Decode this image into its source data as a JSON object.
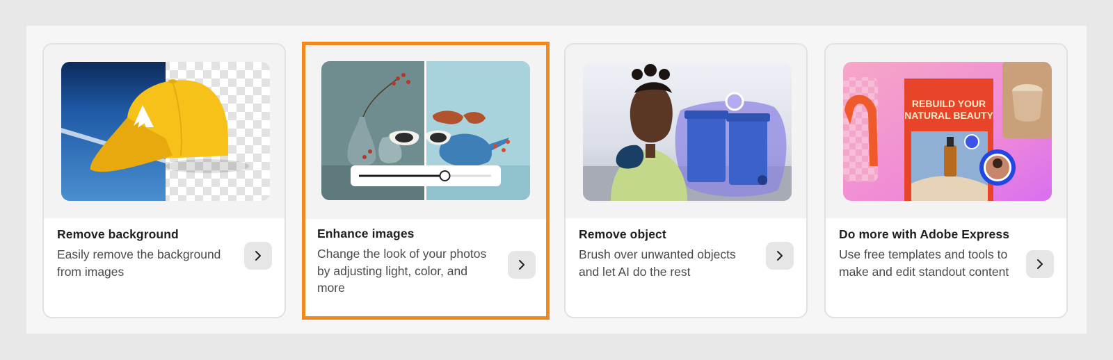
{
  "cards": [
    {
      "title": "Remove background",
      "description": "Easily remove the background from images",
      "image": "yellow-cap-background-removed",
      "arrow_icon": "chevron-right-icon"
    },
    {
      "title": "Enhance images",
      "description": "Change the look of your photos by adjusting light, color, and more",
      "image": "vases-sunglasses-before-after",
      "slider_level": 0.65,
      "arrow_icon": "chevron-right-icon",
      "selected": true
    },
    {
      "title": "Remove object",
      "description": "Brush over unwanted objects and let AI do the rest",
      "image": "woman-with-trash-bins",
      "arrow_icon": "chevron-right-icon"
    },
    {
      "title": "Do more with Adobe Express",
      "description": "Use free templates and tools to make and edit standout content",
      "image": "express-collage",
      "poster_text": "REBUILD YOUR NATURAL BEAUTY",
      "arrow_icon": "chevron-right-icon"
    }
  ],
  "colors": {
    "selected_border": "#f08a1e",
    "card_border": "#e1e1e1",
    "arrow_button_bg": "#e6e6e6"
  }
}
